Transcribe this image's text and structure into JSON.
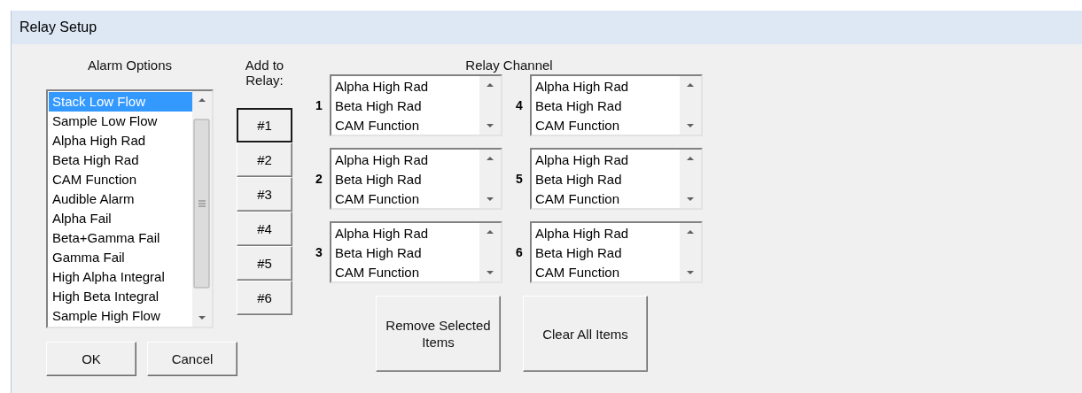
{
  "window": {
    "title": "Relay Setup"
  },
  "alarm_options": {
    "label": "Alarm Options",
    "items": [
      {
        "label": "Stack Low Flow",
        "selected": true
      },
      {
        "label": "Sample Low Flow",
        "selected": false
      },
      {
        "label": "Alpha High Rad",
        "selected": false
      },
      {
        "label": "Beta High Rad",
        "selected": false
      },
      {
        "label": "CAM Function",
        "selected": false
      },
      {
        "label": "Audible Alarm",
        "selected": false
      },
      {
        "label": "Alpha Fail",
        "selected": false
      },
      {
        "label": "Beta+Gamma Fail",
        "selected": false
      },
      {
        "label": "Gamma Fail",
        "selected": false
      },
      {
        "label": "High Alpha Integral",
        "selected": false
      },
      {
        "label": "High Beta Integral",
        "selected": false
      },
      {
        "label": "Sample High Flow",
        "selected": false
      }
    ]
  },
  "add_to_relay": {
    "label": "Add to Relay:",
    "buttons": [
      {
        "label": "#1",
        "focused": true
      },
      {
        "label": "#2",
        "focused": false
      },
      {
        "label": "#3",
        "focused": false
      },
      {
        "label": "#4",
        "focused": false
      },
      {
        "label": "#5",
        "focused": false
      },
      {
        "label": "#6",
        "focused": false
      }
    ]
  },
  "relay_channel": {
    "label": "Relay Channel",
    "channels": [
      {
        "number": "1",
        "items": [
          "Alpha High Rad",
          "Beta High Rad",
          "CAM Function"
        ]
      },
      {
        "number": "4",
        "items": [
          "Alpha High Rad",
          "Beta High Rad",
          "CAM Function"
        ]
      },
      {
        "number": "2",
        "items": [
          "Alpha High Rad",
          "Beta High Rad",
          "CAM Function"
        ]
      },
      {
        "number": "5",
        "items": [
          "Alpha High Rad",
          "Beta High Rad",
          "CAM Function"
        ]
      },
      {
        "number": "3",
        "items": [
          "Alpha High Rad",
          "Beta High Rad",
          "CAM Function"
        ]
      },
      {
        "number": "6",
        "items": [
          "Alpha High Rad",
          "Beta High Rad",
          "CAM Function"
        ]
      }
    ]
  },
  "action_buttons": [
    "Remove Selected Items",
    "Clear All Items"
  ],
  "dialog_buttons": [
    "OK",
    "Cancel"
  ]
}
